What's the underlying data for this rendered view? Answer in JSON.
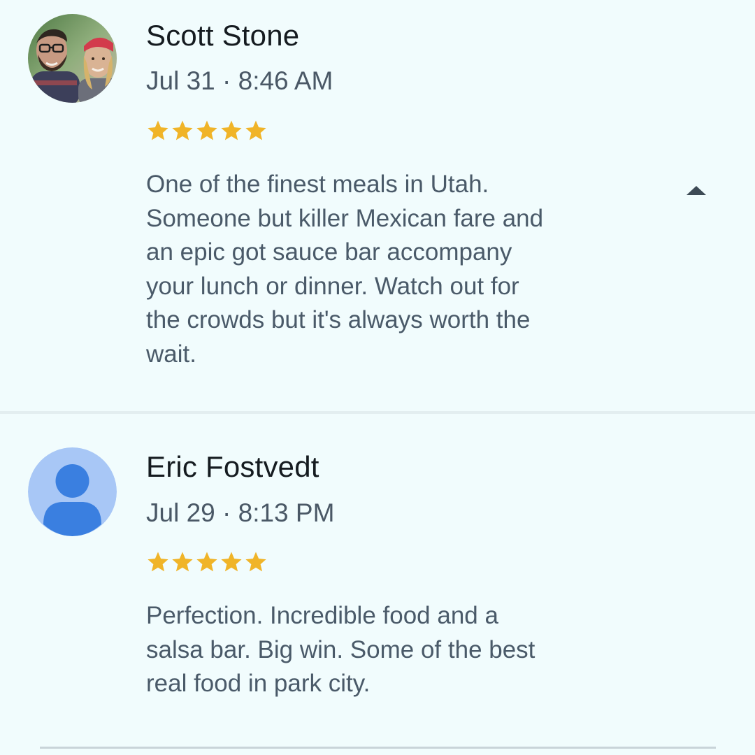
{
  "colors": {
    "background": "#f1fcfd",
    "name": "#151b20",
    "secondary_text": "#4a5a69",
    "star": "#f0b428",
    "default_avatar_bg": "#a8c7f6",
    "default_avatar_fg": "#3a7fe0",
    "divider": "#c9d4d9"
  },
  "reviews": [
    {
      "author": "Scott Stone",
      "avatar": "user-photo",
      "date": "Jul 31",
      "separator": "·",
      "time": "8:46 AM",
      "rating": 5,
      "text": "One of the finest meals in Utah.\nSomeone but killer Mexican fare and\nan epic got sauce bar accompany\nyour lunch or dinner. Watch out for\nthe crowds but it's always worth the\nwait.",
      "expanded": true,
      "toggle_icon": "chevron-up-icon"
    },
    {
      "author": "Eric Fostvedt",
      "avatar": "default-person-icon",
      "date": "Jul 29",
      "separator": "·",
      "time": "8:13 PM",
      "rating": 5,
      "text": "Perfection. Incredible food and a\nsalsa bar.  Big win.  Some of the best\nreal food in park city."
    }
  ]
}
